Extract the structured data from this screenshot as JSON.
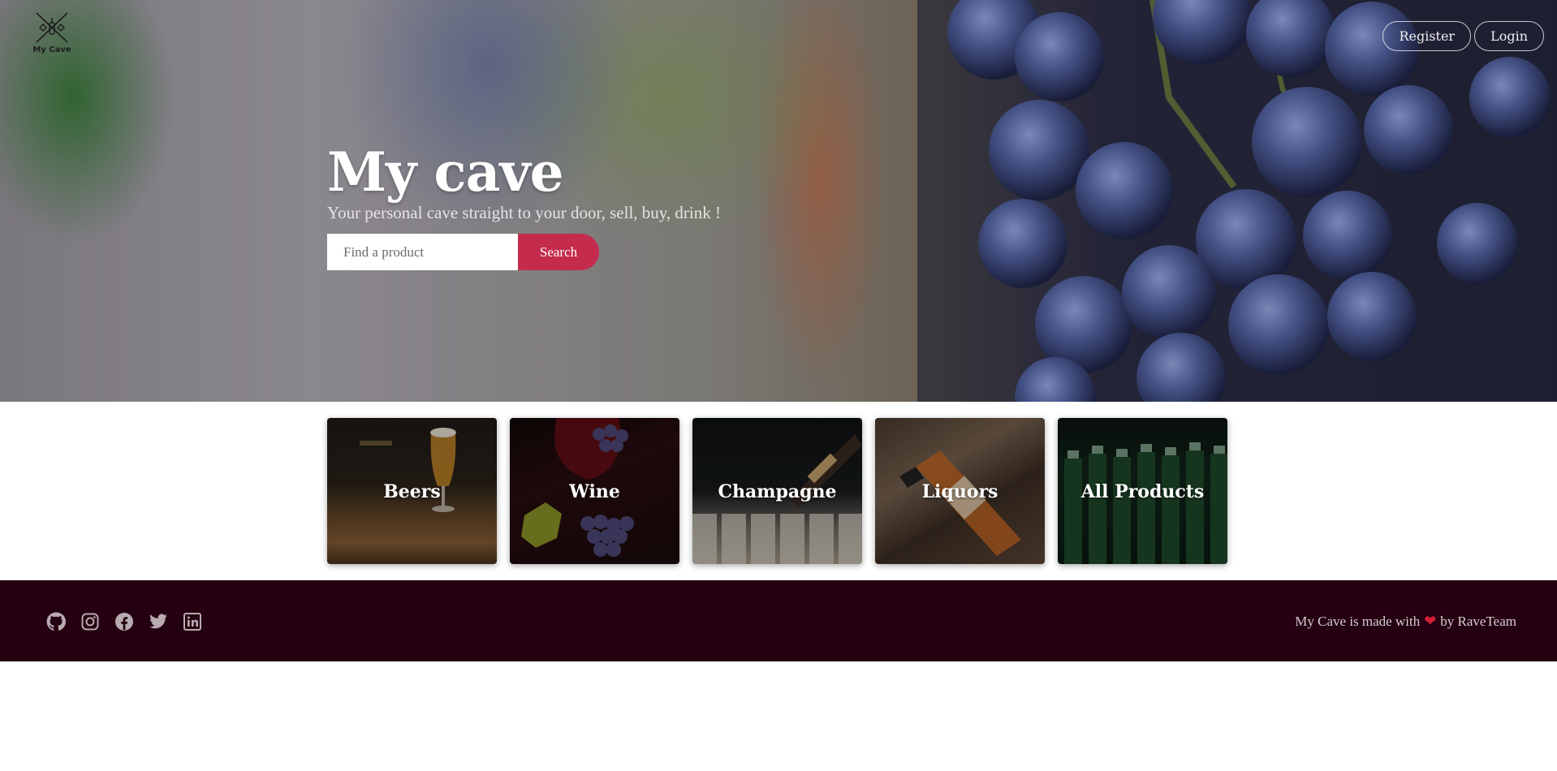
{
  "header": {
    "logo_text": "My Cave",
    "actions": {
      "register_label": "Register",
      "login_label": "Login"
    }
  },
  "hero": {
    "title": "My cave",
    "subtitle": "Your personal cave straight to your door, sell, buy, drink !",
    "search": {
      "placeholder": "Find a product",
      "value": "",
      "button_label": "Search"
    }
  },
  "categories": [
    {
      "label": "Beers"
    },
    {
      "label": "Wine"
    },
    {
      "label": "Champagne"
    },
    {
      "label": "Liquors"
    },
    {
      "label": "All Products"
    }
  ],
  "footer": {
    "social_icons": [
      "github-icon",
      "instagram-icon",
      "facebook-icon",
      "twitter-icon",
      "linkedin-icon"
    ],
    "made_with_prefix": "My Cave is made with",
    "made_with_suffix": "by RaveTeam"
  },
  "colors": {
    "accent": "#c42b4c",
    "footer_background": "#240010",
    "heart": "#d11f34"
  }
}
